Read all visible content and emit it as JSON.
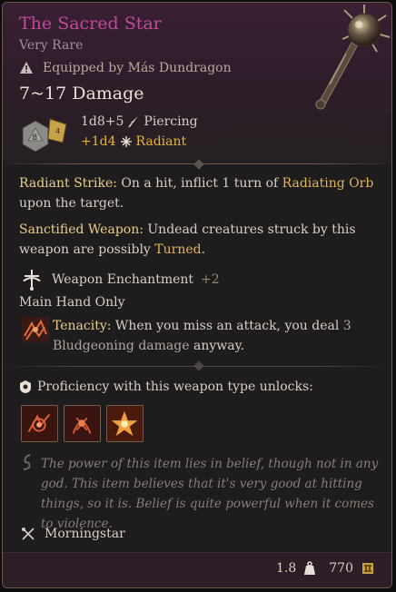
{
  "item": {
    "name": "The Sacred Star",
    "rarity": "Very Rare",
    "equipped_by": "Equipped by Más Dundragon",
    "damage_total": "7~17 Damage",
    "damage_dice": "1d8+5",
    "damage_type": "Piercing",
    "bonus_dice": "+1d4",
    "bonus_type": "Radiant",
    "dice_face": "8"
  },
  "abilities": {
    "radiant_strike": {
      "title": "Radiant Strike:",
      "text_a": " On a hit, inflict 1 turn of ",
      "highlight": "Radiating Orb",
      "text_b": " upon the target."
    },
    "sanctified": {
      "title": "Sanctified Weapon:",
      "text_a": " Undead creatures struck by this weapon are possibly ",
      "highlight": "Turned",
      "text_b": "."
    },
    "enchantment": {
      "label": "Weapon Enchantment",
      "value": "+2"
    },
    "main_hand": "Main Hand Only",
    "tenacity": {
      "title": "Tenacity:",
      "text_a": " When you miss an attack, you deal ",
      "highlight_num": "3",
      "highlight": " Bludgeoning damage",
      "text_b": " anyway."
    }
  },
  "proficiency": {
    "label": "Proficiency with this weapon type unlocks:",
    "actions": [
      "action-1",
      "action-2",
      "action-3"
    ]
  },
  "flavor": "The power of this item lies in belief, though not in any god. This item believes that it's very good at hitting things, so it is. Belief is quite powerful when it comes to violence.",
  "weapon_type": "Morningstar",
  "footer": {
    "weight": "1.8",
    "value": "770"
  },
  "colors": {
    "title": "#c04a9a",
    "radiant": "#e2b53a",
    "keyword": "#e8cf8a"
  }
}
